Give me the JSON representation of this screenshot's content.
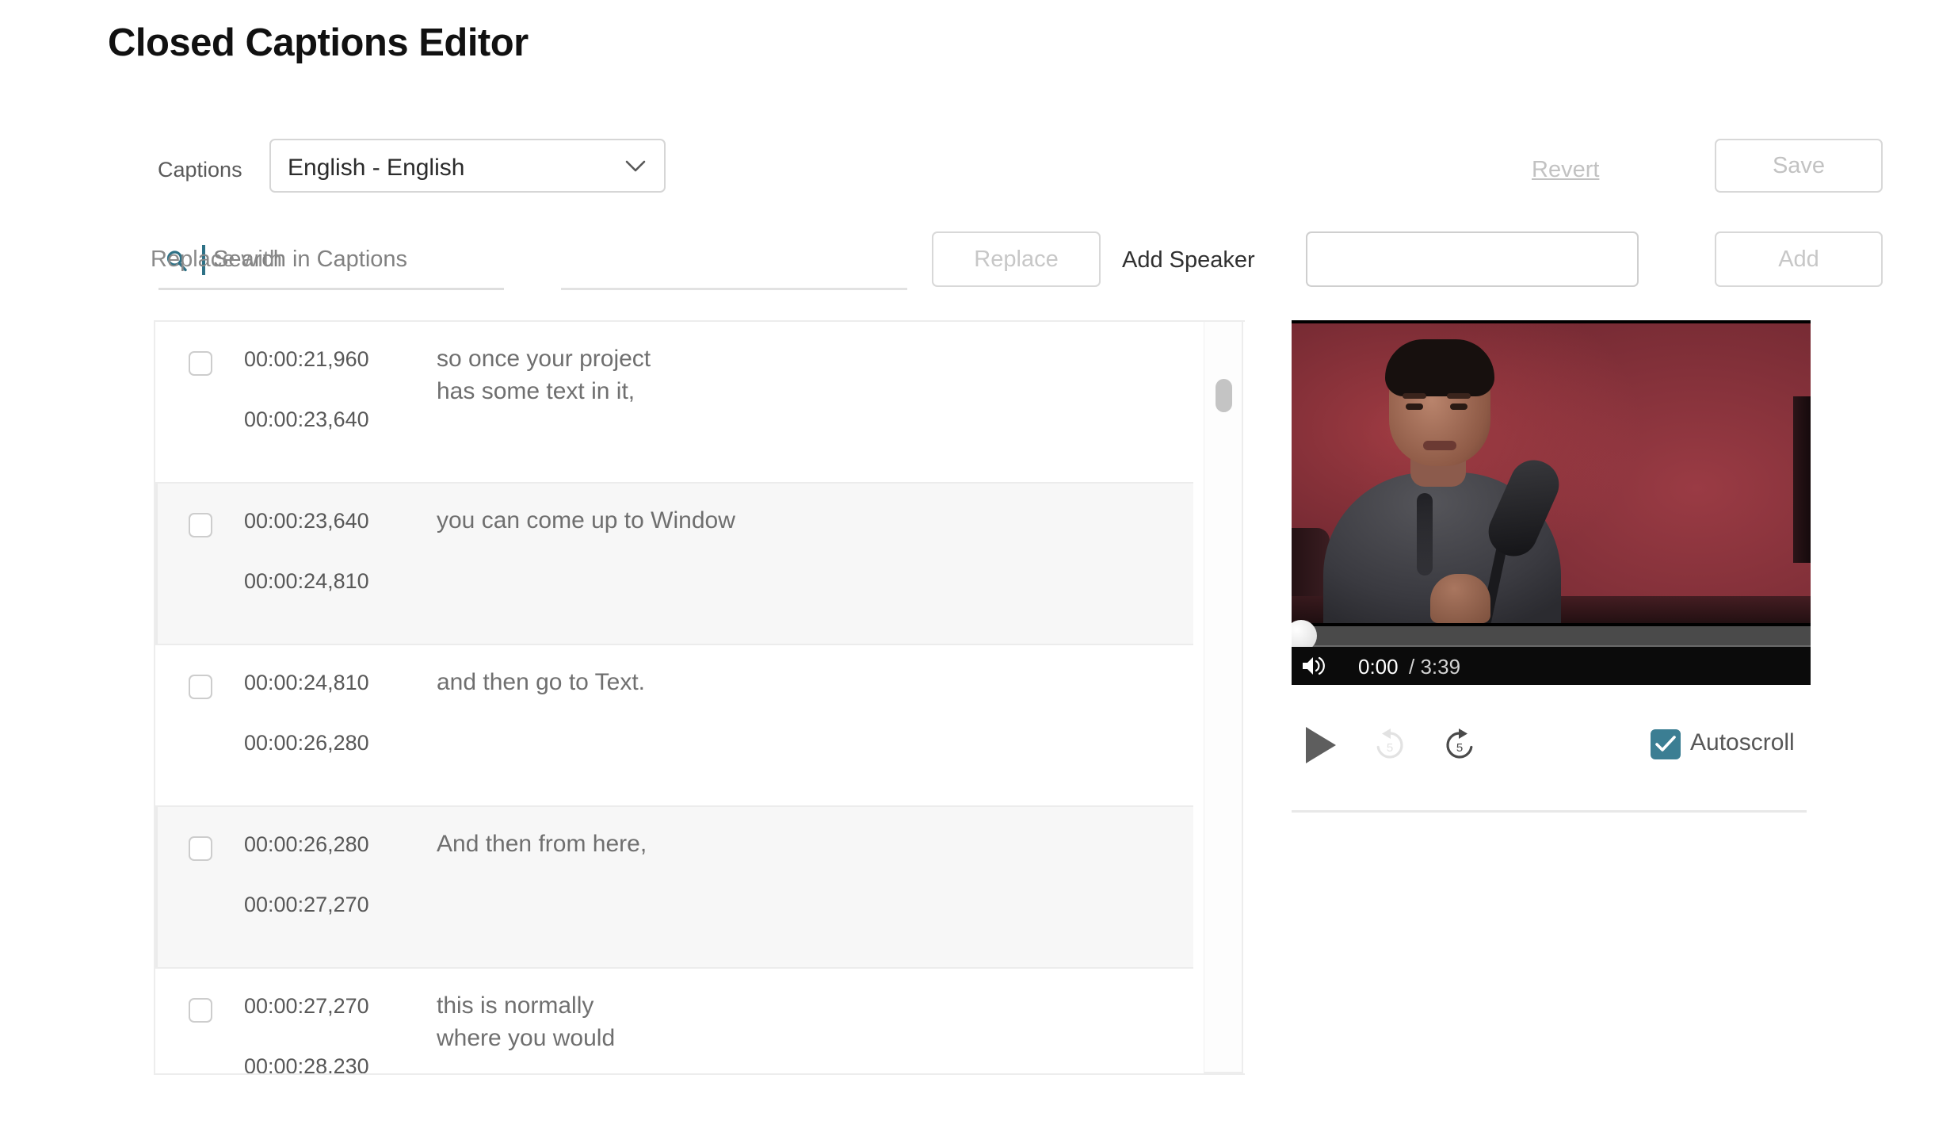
{
  "page": {
    "title": "Closed Captions Editor"
  },
  "captions_selector": {
    "label": "Captions",
    "selected": "English - English",
    "chevron_icon": "chevron-down-icon",
    "options": [
      "English - English"
    ]
  },
  "actions": {
    "revert_label": "Revert",
    "save_label": "Save"
  },
  "toolbar": {
    "search_icon": "search-icon",
    "search_placeholder": "Search in Captions",
    "search_value": "",
    "replace_placeholder": "Replace with",
    "replace_value": "",
    "replace_button_label": "Replace",
    "add_speaker_label": "Add Speaker",
    "speaker_value": "",
    "speaker_placeholder": "",
    "add_button_label": "Add"
  },
  "caption_rows": [
    {
      "start": "00:00:21,960",
      "end": "00:00:23,640",
      "text": "so once your project\nhas some text in it,",
      "checked": false
    },
    {
      "start": "00:00:23,640",
      "end": "00:00:24,810",
      "text": "you can come up to Window",
      "checked": false
    },
    {
      "start": "00:00:24,810",
      "end": "00:00:26,280",
      "text": "and then go to Text.",
      "checked": false
    },
    {
      "start": "00:00:26,280",
      "end": "00:00:27,270",
      "text": "And then from here,",
      "checked": false
    },
    {
      "start": "00:00:27,270",
      "end": "00:00:28,230",
      "text": "this is normally\nwhere you would",
      "checked": false
    }
  ],
  "player": {
    "volume_icon": "volume-high-icon",
    "current_time": "0:00",
    "total_time": "/ 3:39",
    "play_icon": "play-icon",
    "rewind_icon": "rewind-5-icon",
    "forward_icon": "forward-5-icon",
    "autoscroll_label": "Autoscroll",
    "autoscroll_checked": true,
    "checkmark_icon": "check-icon"
  },
  "colors": {
    "accent_teal": "#3b7e93",
    "search_icon_teal": "#2e7186",
    "disabled_gray": "#c4c4c4",
    "row_alt_bg": "#f7f7f7",
    "text_gray": "#6f6f6f"
  }
}
